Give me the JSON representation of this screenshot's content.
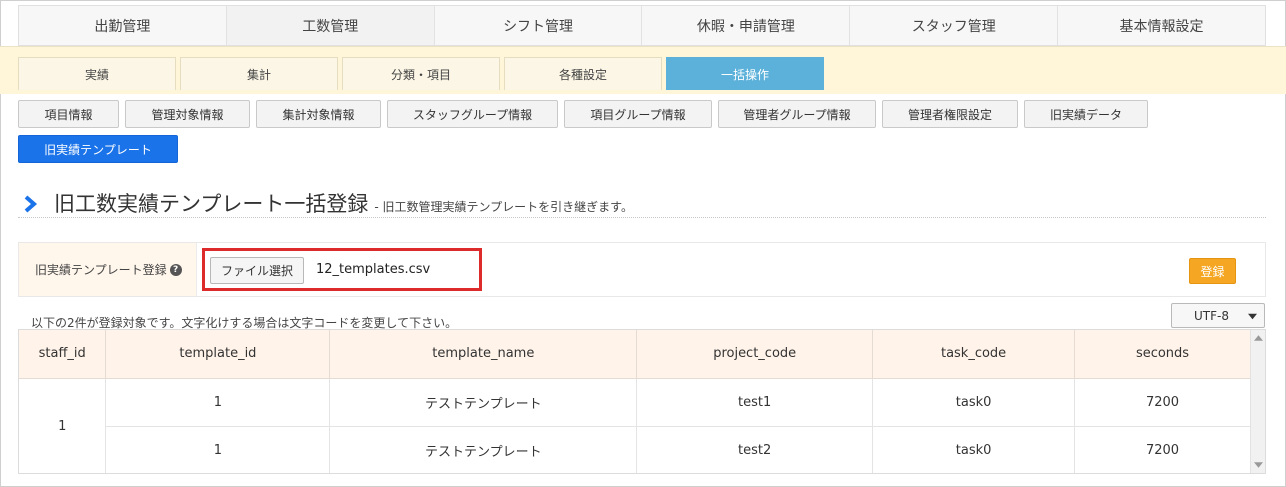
{
  "top_tabs": [
    "出勤管理",
    "工数管理",
    "シフト管理",
    "休暇・申請管理",
    "スタッフ管理",
    "基本情報設定"
  ],
  "sub_tabs": [
    "実績",
    "集計",
    "分類・項目",
    "各種設定",
    "一括操作"
  ],
  "buttons": [
    "項目情報",
    "管理対象情報",
    "集計対象情報",
    "スタッフグループ情報",
    "項目グループ情報",
    "管理者グループ情報",
    "管理者権限設定",
    "旧実績データ",
    "旧実績テンプレート"
  ],
  "heading": {
    "title": "旧工数実績テンプレート一括登録",
    "subtitle": "- 旧工数管理実績テンプレートを引き継ぎます。"
  },
  "upload": {
    "label": "旧実績テンプレート登録",
    "file_button": "ファイル選択",
    "file_name": "12_templates.csv",
    "register_button": "登録"
  },
  "info_text": "以下の2件が登録対象です。文字化けする場合は文字コードを変更して下さい。",
  "encoding": "UTF-8",
  "table": {
    "headers": [
      "staff_id",
      "template_id",
      "template_name",
      "project_code",
      "task_code",
      "seconds"
    ],
    "staff_id": "1",
    "rows": [
      {
        "template_id": "1",
        "template_name": "テストテンプレート",
        "project_code": "test1",
        "task_code": "task0",
        "seconds": "7200"
      },
      {
        "template_id": "1",
        "template_name": "テストテンプレート",
        "project_code": "test2",
        "task_code": "task0",
        "seconds": "7200"
      }
    ]
  },
  "colors": {
    "active_sub_tab": "#5bb1d9",
    "active_button": "#1a73e8",
    "register_button": "#f5a623",
    "highlight_border": "#dd2a2a",
    "heading_chevron": "#1a73e8"
  },
  "icons": {
    "heading": "chevron-right-icon",
    "help": "question-circle-icon",
    "select": "chevron-down-icon"
  }
}
